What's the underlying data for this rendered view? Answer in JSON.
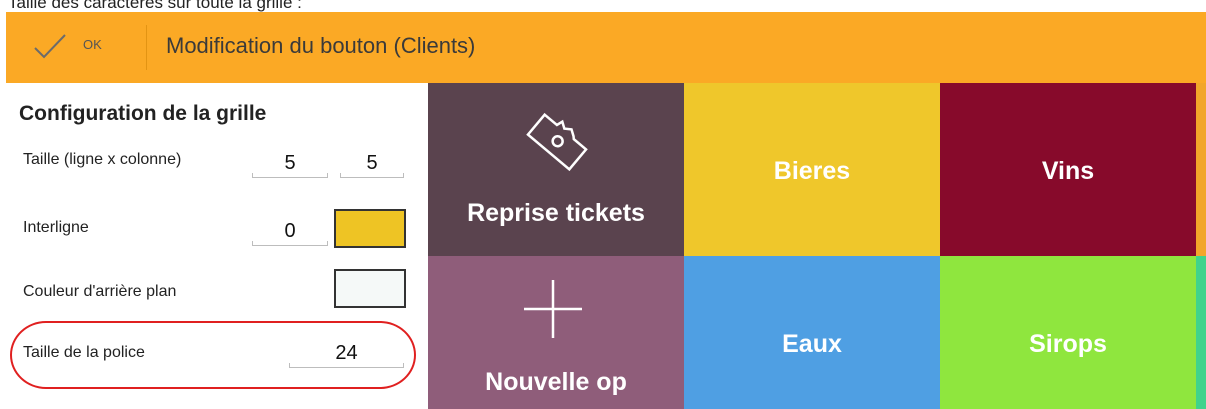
{
  "caption": "Taille des caractères sur toute la grille :",
  "toolbar": {
    "ok_label": "OK",
    "title": "Modification du bouton (Clients)",
    "color": "#fba925"
  },
  "config": {
    "title": "Configuration de la grille",
    "rows": {
      "size": {
        "label": "Taille (ligne x colonne)",
        "rows_value": "5",
        "cols_value": "5"
      },
      "spacing": {
        "label": "Interligne",
        "value": "0",
        "swatch_color": "#eec424"
      },
      "background": {
        "label": "Couleur d'arrière plan",
        "swatch_color": "#f5f9f8"
      },
      "font_size": {
        "label": "Taille de la police",
        "value": "24"
      }
    }
  },
  "grid": {
    "tiles": [
      {
        "label": "Reprise tickets",
        "color": "#5a434e",
        "icon": "ticket-icon"
      },
      {
        "label": "Bieres",
        "color": "#efc72b"
      },
      {
        "label": "Vins",
        "color": "#870a2b"
      },
      {
        "label": "Nouvelle op",
        "color": "#8f5d7a",
        "icon": "plus-icon"
      },
      {
        "label": "Eaux",
        "color": "#4f9fe3"
      },
      {
        "label": "Sirops",
        "color": "#8fe63e"
      }
    ]
  }
}
